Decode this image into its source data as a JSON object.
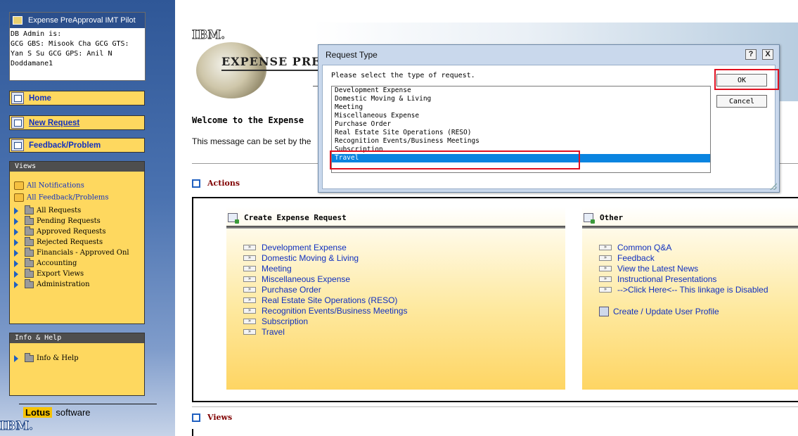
{
  "sidebar": {
    "app_title": "Expense PreApproval IMT Pilot",
    "admin_text": " DB Admin is:\nGCG GBS: Misook Cha GCG GTS:\nYan S Su GCG GPS: Anil N\nDoddamane1",
    "nav": {
      "home": "Home",
      "new_request": "New Request",
      "feedback": "Feedback/Problem"
    },
    "views_header": "Views",
    "views_items": [
      {
        "label": "All Notifications",
        "kind": "link"
      },
      {
        "label": "All Feedback/Problems",
        "kind": "link"
      },
      {
        "label": "All Requests",
        "kind": "folder"
      },
      {
        "label": "Pending Requests",
        "kind": "folder"
      },
      {
        "label": "Approved Requests",
        "kind": "folder"
      },
      {
        "label": "Rejected Requests",
        "kind": "folder"
      },
      {
        "label": "Financials - Approved Onl",
        "kind": "folder"
      },
      {
        "label": "Accounting",
        "kind": "folder"
      },
      {
        "label": "Export Views",
        "kind": "folder"
      },
      {
        "label": "Administration",
        "kind": "folder"
      }
    ],
    "info_header": "Info & Help",
    "info_items": [
      "Info & Help"
    ],
    "lotus_word": "Lotus",
    "software_word": "software",
    "ibm": "IBM."
  },
  "main": {
    "ibm_logo": "IBM.",
    "brand": "EXPENSE PRE-APP",
    "welcome": "Welcome to the Expense",
    "message": "This message can be set by the",
    "actions_header": "Actions",
    "views_header": "Views",
    "create_header": "Create Expense Request",
    "create_links": [
      "Development Expense",
      "Domestic Moving & Living",
      "Meeting",
      "Miscellaneous Expense",
      "Purchase Order",
      "Real Estate Site Operations (RESO)",
      "Recognition Events/Business Meetings",
      "Subscription",
      "Travel"
    ],
    "other_header": "Other",
    "other_links": [
      "Common Q&A",
      "Feedback",
      "View the Latest News",
      "Instructional Presentations",
      "-->Click Here<-- This linkage is Disabled"
    ],
    "profile_link": "Create / Update User Profile",
    "link_arrow": "»"
  },
  "dialog": {
    "title": "Request Type",
    "help": "?",
    "close": "X",
    "prompt": "Please select the type of request.",
    "options": [
      "Development Expense",
      "Domestic Moving & Living",
      "Meeting",
      "Miscellaneous Expense",
      "Purchase Order",
      "Real Estate Site Operations (RESO)",
      "Recognition Events/Business Meetings",
      "Subscription",
      "Travel"
    ],
    "selected": "Travel",
    "ok": "OK",
    "cancel": "Cancel"
  },
  "colors": {
    "highlight": "#e01020",
    "selection": "#0a84e0",
    "panel_yellow": "#fed85f",
    "sidebar_blue": "#2f5797"
  }
}
